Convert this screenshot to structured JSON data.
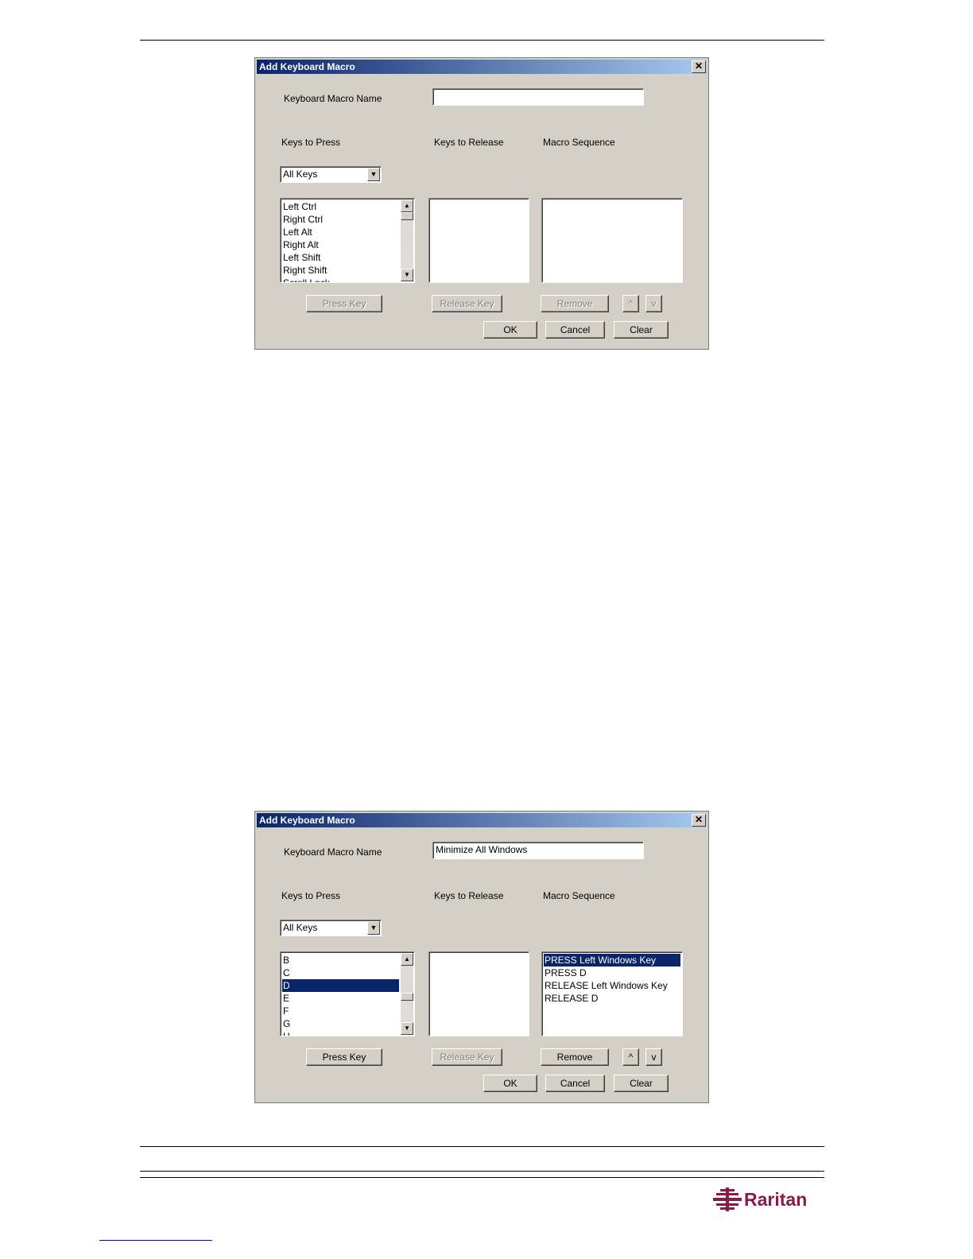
{
  "dialogs": [
    {
      "title": "Add Keyboard Macro",
      "close_glyph": "✕",
      "name_label": "Keyboard Macro Name",
      "name_value": "",
      "keys_to_press_label": "Keys to Press",
      "keys_to_release_label": "Keys to Release",
      "macro_sequence_label": "Macro Sequence",
      "key_filter": "All Keys",
      "keys_list": [
        "Left Ctrl",
        "Right Ctrl",
        "Left Alt",
        "Right Alt",
        "Left Shift",
        "Right Shift",
        "Scroll Lock"
      ],
      "keys_selected": "",
      "release_list": [],
      "sequence_list": [],
      "sequence_selected": "",
      "buttons": {
        "press_key": "Press Key",
        "release_key": "Release Key",
        "remove": "Remove",
        "move_up": "^",
        "move_down": "v",
        "ok": "OK",
        "cancel": "Cancel",
        "clear": "Clear"
      },
      "press_enabled": false,
      "remove_enabled": false,
      "move_enabled": false
    },
    {
      "title": "Add Keyboard Macro",
      "close_glyph": "✕",
      "name_label": "Keyboard Macro Name",
      "name_value": "Minimize All Windows",
      "keys_to_press_label": "Keys to Press",
      "keys_to_release_label": "Keys to Release",
      "macro_sequence_label": "Macro Sequence",
      "key_filter": "All Keys",
      "keys_list": [
        "B",
        "C",
        "D",
        "E",
        "F",
        "G",
        "H"
      ],
      "keys_selected": "D",
      "release_list": [],
      "sequence_list": [
        "PRESS Left Windows Key",
        "PRESS D",
        "RELEASE Left Windows Key",
        "RELEASE D"
      ],
      "sequence_selected": "PRESS Left Windows Key",
      "buttons": {
        "press_key": "Press Key",
        "release_key": "Release Key",
        "remove": "Remove",
        "move_up": "^",
        "move_down": "v",
        "ok": "OK",
        "cancel": "Cancel",
        "clear": "Clear"
      },
      "press_enabled": true,
      "remove_enabled": true,
      "move_enabled": true
    }
  ],
  "logo": {
    "text": "Raritan",
    "color": "#8b1a4a"
  },
  "colors": {
    "selection": "#0a246a",
    "dialog_bg": "#d4d0c8",
    "titlebar_start": "#0a246a",
    "titlebar_end": "#a6caf0"
  }
}
